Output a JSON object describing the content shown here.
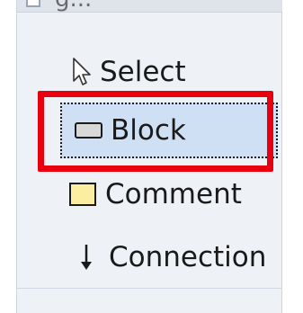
{
  "header": {
    "cut_text": "g..."
  },
  "tools": {
    "select": {
      "label": "Select",
      "icon": "pointer-arrow-icon"
    },
    "block": {
      "label": "Block",
      "icon": "block-rectangle-icon",
      "selected": true
    },
    "comment": {
      "label": "Comment",
      "icon": "comment-note-icon"
    },
    "connection": {
      "label": "Connection",
      "icon": "down-arrow-icon"
    }
  },
  "colors": {
    "panel_bg": "#eef1f6",
    "selected_bg": "#cfe0f5",
    "highlight": "#e8000f",
    "comment_fill": "#fbeea0"
  }
}
